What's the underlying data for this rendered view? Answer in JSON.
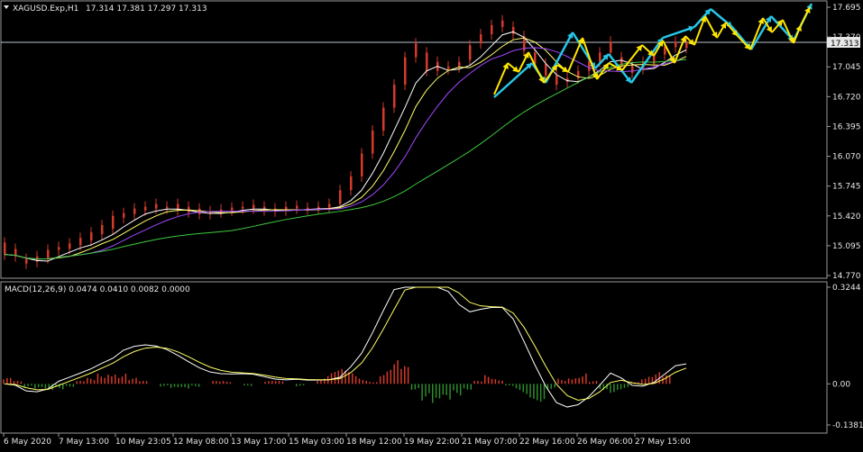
{
  "window": {
    "symbol_header": "XAGUSD.Exp,H1",
    "ohlc_header": "17.314 17.381 17.297 17.313",
    "current_price_tag": "17.313"
  },
  "macd": {
    "label": "MACD(12,26,9) 0.0474 0.0410 0.0082 0.0000"
  },
  "colors": {
    "background": "#000000",
    "bull": "#27b331",
    "bear": "#d63a2b",
    "ma_fast": "#ffffff",
    "ma_mid": "#ffff66",
    "ma_slow": "#a146ff",
    "ma_long": "#3cc93c",
    "arrows_yellow": "#ffe600",
    "arrows_cyan": "#27c6e6",
    "macd_line": "#ffffff",
    "macd_signal": "#ffff66",
    "hist_pos": "#d63a2b",
    "hist_neg": "#2e8b2e"
  },
  "chart_data": [
    {
      "type": "candlestick",
      "price_scale": [
        "17.695",
        "17.370",
        "17.045",
        "16.720",
        "16.395",
        "16.070",
        "15.745",
        "15.420",
        "15.095",
        "14.770"
      ],
      "ylim": [
        14.77,
        17.695
      ],
      "time_labels": [
        "6 May 2020",
        "7 May 13:00",
        "10 May 23:05",
        "12 May 08:00",
        "13 May 17:00",
        "15 May 03:00",
        "18 May 12:00",
        "19 May 22:00",
        "21 May 07:00",
        "22 May 16:00",
        "26 May 06:00",
        "27 May 15:00"
      ],
      "last_close": 17.313,
      "candles": [
        [
          0,
          15.13,
          15.0
        ],
        [
          3,
          15.06,
          14.98
        ],
        [
          6,
          14.95,
          14.9
        ],
        [
          9,
          14.98,
          14.92
        ],
        [
          12,
          15.05,
          14.96
        ],
        [
          15,
          15.08,
          15.05
        ],
        [
          18,
          15.12,
          15.06
        ],
        [
          21,
          15.18,
          15.1
        ],
        [
          24,
          15.24,
          15.15
        ],
        [
          27,
          15.32,
          15.22
        ],
        [
          30,
          15.42,
          15.28
        ],
        [
          33,
          15.45,
          15.4
        ],
        [
          36,
          15.5,
          15.44
        ],
        [
          39,
          15.52,
          15.48
        ],
        [
          42,
          15.55,
          15.5
        ],
        [
          45,
          15.52,
          15.5
        ],
        [
          48,
          15.55,
          15.48
        ],
        [
          51,
          15.52,
          15.46
        ],
        [
          54,
          15.5,
          15.44
        ],
        [
          57,
          15.47,
          15.44
        ],
        [
          60,
          15.49,
          15.46
        ],
        [
          63,
          15.51,
          15.48
        ],
        [
          66,
          15.52,
          15.5
        ],
        [
          69,
          15.54,
          15.5
        ],
        [
          72,
          15.52,
          15.48
        ],
        [
          75,
          15.5,
          15.47
        ],
        [
          78,
          15.52,
          15.48
        ],
        [
          81,
          15.53,
          15.5
        ],
        [
          84,
          15.51,
          15.49
        ],
        [
          87,
          15.52,
          15.5
        ],
        [
          90,
          15.55,
          15.51
        ],
        [
          93,
          15.7,
          15.55
        ],
        [
          96,
          15.85,
          15.7
        ],
        [
          99,
          16.1,
          15.85
        ],
        [
          102,
          16.35,
          16.1
        ],
        [
          105,
          16.6,
          16.35
        ],
        [
          108,
          16.85,
          16.6
        ],
        [
          111,
          17.15,
          16.85
        ],
        [
          114,
          17.3,
          17.15
        ],
        [
          117,
          17.2,
          17.0
        ],
        [
          120,
          17.1,
          17.0
        ],
        [
          123,
          17.05,
          17.02
        ],
        [
          126,
          17.1,
          17.04
        ],
        [
          129,
          17.28,
          17.12
        ],
        [
          132,
          17.4,
          17.3
        ],
        [
          135,
          17.5,
          17.4
        ],
        [
          138,
          17.55,
          17.48
        ],
        [
          141,
          17.48,
          17.4
        ],
        [
          144,
          17.38,
          17.22
        ],
        [
          147,
          17.2,
          17.08
        ],
        [
          150,
          17.08,
          16.95
        ],
        [
          153,
          16.95,
          16.85
        ],
        [
          156,
          16.92,
          16.88
        ],
        [
          159,
          17.0,
          16.92
        ],
        [
          162,
          17.1,
          17.0
        ],
        [
          165,
          17.2,
          17.1
        ],
        [
          168,
          17.32,
          17.2
        ],
        [
          171,
          17.15,
          17.05
        ],
        [
          174,
          17.06,
          16.98
        ],
        [
          177,
          17.1,
          17.02
        ],
        [
          180,
          17.18,
          17.08
        ],
        [
          183,
          17.26,
          17.18
        ],
        [
          186,
          17.32,
          17.26
        ],
        [
          189,
          17.31,
          17.25
        ]
      ]
    },
    {
      "type": "bar",
      "title": "MACD(12,26,9) 0.0474 0.0410 0.0082 0.0000",
      "ylim": [
        -0.1381,
        0.3244
      ],
      "scale_labels": [
        "0.3244",
        "0.00",
        "-0.1381"
      ],
      "histogram": [
        0.02,
        0.01,
        -0.01,
        -0.02,
        -0.03,
        -0.02,
        -0.01,
        0.01,
        0.02,
        0.04,
        0.05,
        0.04,
        0.02,
        0.01,
        0.0,
        -0.01,
        -0.02,
        -0.02,
        -0.01,
        0.0,
        0.01,
        0.01,
        0.0,
        -0.01,
        0.0,
        0.01,
        0.01,
        0.0,
        -0.01,
        0.0,
        0.02,
        0.04,
        0.05,
        0.04,
        0.02,
        0.01,
        0.05,
        0.08,
        0.06,
        -0.02,
        -0.06,
        -0.09,
        -0.07,
        -0.04,
        -0.02,
        0.01,
        0.03,
        0.02,
        -0.01,
        -0.03,
        -0.05,
        -0.06,
        -0.02,
        0.02,
        0.03,
        0.04,
        0.01,
        -0.02,
        -0.03,
        -0.02,
        0.01,
        0.03,
        0.04,
        0.03
      ]
    }
  ]
}
